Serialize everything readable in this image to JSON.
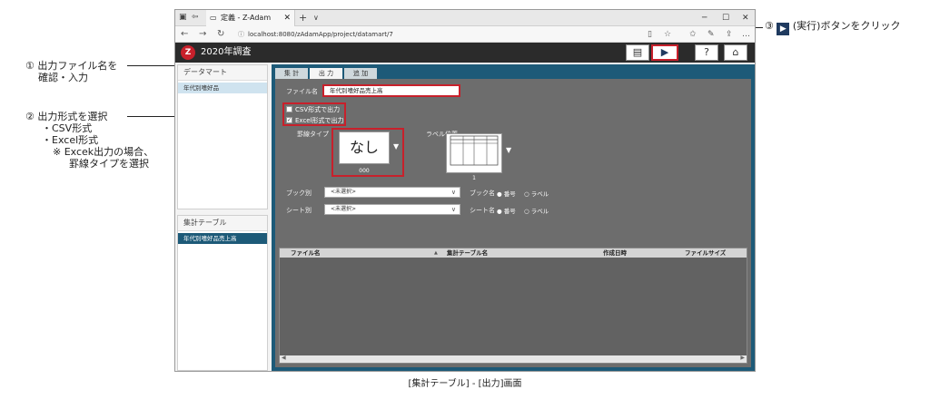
{
  "browser": {
    "tab_title": "定義 - Z-Adam",
    "url": "localhost:8080/zAdamApp/project/datamart/7"
  },
  "app": {
    "title": "2020年調査"
  },
  "sidebar": {
    "datamart_header": "データマート",
    "datamart_item": "年代別嗜好品",
    "table_header": "集計テーブル",
    "table_item": "年代別嗜好品売上高"
  },
  "main": {
    "tabs": [
      {
        "label": "集 計"
      },
      {
        "label": "出 力"
      },
      {
        "label": "追 加"
      }
    ],
    "file_label": "ファイル名",
    "file_value": "年代別嗜好品売上高",
    "csv_label": "CSV形式で出力",
    "excel_label": "Excel形式で出力",
    "border_type_label": "罫線タイプ",
    "border_preview_text": "なし",
    "border_code": "000",
    "label_pos_label": "ラベル位置",
    "label_pos_code": "1",
    "book_label": "ブック別",
    "book_value": "<未選択>",
    "book_name_label": "ブック名",
    "sheet_label": "シート別",
    "sheet_value": "<未選択>",
    "sheet_name_label": "シート名",
    "radio_number": "番号",
    "radio_label": "ラベル",
    "table_headers": [
      "ファイル名",
      "集計テーブル名",
      "作成日時",
      "ファイルサイズ"
    ]
  },
  "annotations": {
    "a1_line1": "① 出力ファイル名を",
    "a1_line2": "確認・入力",
    "a2_line1": "② 出力形式を選択",
    "a2_line2": "・CSV形式",
    "a2_line3": "・Excel形式",
    "a2_line4": "※ Excek出力の場合、",
    "a2_line5": "罫線タイプを選択",
    "a3_prefix": "③",
    "a3_suffix": "(実行)ボタンをクリック",
    "caption": "[集計テーブル] - [出力]画面"
  },
  "colors": {
    "highlight_red": "#c8202b",
    "header_dark": "#2b2b2b",
    "main_blue": "#1d5a78",
    "content_gray": "#6d6d6d"
  }
}
